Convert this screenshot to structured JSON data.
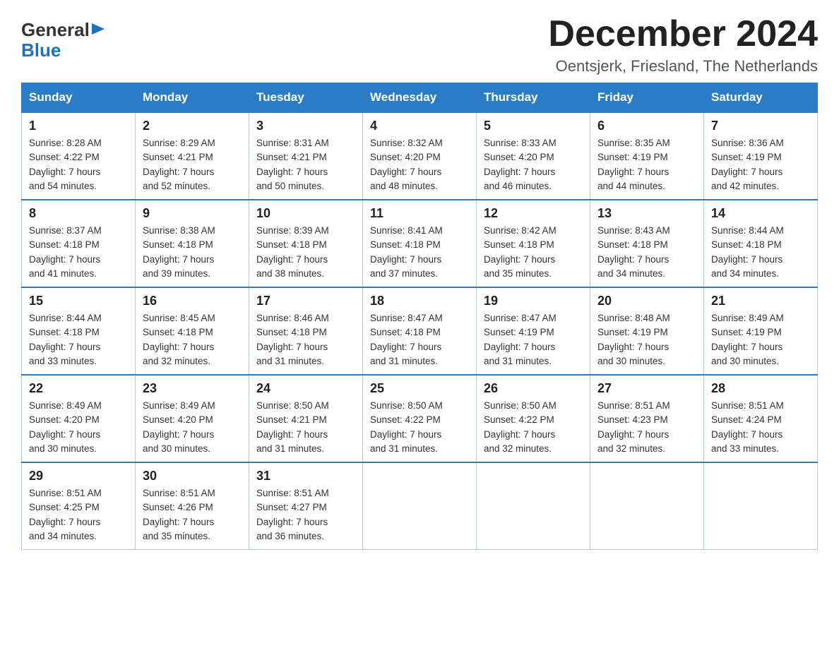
{
  "header": {
    "logo_general": "General",
    "logo_blue": "Blue",
    "month_title": "December 2024",
    "location": "Oentsjerk, Friesland, The Netherlands"
  },
  "days_of_week": [
    "Sunday",
    "Monday",
    "Tuesday",
    "Wednesday",
    "Thursday",
    "Friday",
    "Saturday"
  ],
  "weeks": [
    [
      {
        "day": "1",
        "sunrise": "8:28 AM",
        "sunset": "4:22 PM",
        "daylight": "7 hours and 54 minutes."
      },
      {
        "day": "2",
        "sunrise": "8:29 AM",
        "sunset": "4:21 PM",
        "daylight": "7 hours and 52 minutes."
      },
      {
        "day": "3",
        "sunrise": "8:31 AM",
        "sunset": "4:21 PM",
        "daylight": "7 hours and 50 minutes."
      },
      {
        "day": "4",
        "sunrise": "8:32 AM",
        "sunset": "4:20 PM",
        "daylight": "7 hours and 48 minutes."
      },
      {
        "day": "5",
        "sunrise": "8:33 AM",
        "sunset": "4:20 PM",
        "daylight": "7 hours and 46 minutes."
      },
      {
        "day": "6",
        "sunrise": "8:35 AM",
        "sunset": "4:19 PM",
        "daylight": "7 hours and 44 minutes."
      },
      {
        "day": "7",
        "sunrise": "8:36 AM",
        "sunset": "4:19 PM",
        "daylight": "7 hours and 42 minutes."
      }
    ],
    [
      {
        "day": "8",
        "sunrise": "8:37 AM",
        "sunset": "4:18 PM",
        "daylight": "7 hours and 41 minutes."
      },
      {
        "day": "9",
        "sunrise": "8:38 AM",
        "sunset": "4:18 PM",
        "daylight": "7 hours and 39 minutes."
      },
      {
        "day": "10",
        "sunrise": "8:39 AM",
        "sunset": "4:18 PM",
        "daylight": "7 hours and 38 minutes."
      },
      {
        "day": "11",
        "sunrise": "8:41 AM",
        "sunset": "4:18 PM",
        "daylight": "7 hours and 37 minutes."
      },
      {
        "day": "12",
        "sunrise": "8:42 AM",
        "sunset": "4:18 PM",
        "daylight": "7 hours and 35 minutes."
      },
      {
        "day": "13",
        "sunrise": "8:43 AM",
        "sunset": "4:18 PM",
        "daylight": "7 hours and 34 minutes."
      },
      {
        "day": "14",
        "sunrise": "8:44 AM",
        "sunset": "4:18 PM",
        "daylight": "7 hours and 34 minutes."
      }
    ],
    [
      {
        "day": "15",
        "sunrise": "8:44 AM",
        "sunset": "4:18 PM",
        "daylight": "7 hours and 33 minutes."
      },
      {
        "day": "16",
        "sunrise": "8:45 AM",
        "sunset": "4:18 PM",
        "daylight": "7 hours and 32 minutes."
      },
      {
        "day": "17",
        "sunrise": "8:46 AM",
        "sunset": "4:18 PM",
        "daylight": "7 hours and 31 minutes."
      },
      {
        "day": "18",
        "sunrise": "8:47 AM",
        "sunset": "4:18 PM",
        "daylight": "7 hours and 31 minutes."
      },
      {
        "day": "19",
        "sunrise": "8:47 AM",
        "sunset": "4:19 PM",
        "daylight": "7 hours and 31 minutes."
      },
      {
        "day": "20",
        "sunrise": "8:48 AM",
        "sunset": "4:19 PM",
        "daylight": "7 hours and 30 minutes."
      },
      {
        "day": "21",
        "sunrise": "8:49 AM",
        "sunset": "4:19 PM",
        "daylight": "7 hours and 30 minutes."
      }
    ],
    [
      {
        "day": "22",
        "sunrise": "8:49 AM",
        "sunset": "4:20 PM",
        "daylight": "7 hours and 30 minutes."
      },
      {
        "day": "23",
        "sunrise": "8:49 AM",
        "sunset": "4:20 PM",
        "daylight": "7 hours and 30 minutes."
      },
      {
        "day": "24",
        "sunrise": "8:50 AM",
        "sunset": "4:21 PM",
        "daylight": "7 hours and 31 minutes."
      },
      {
        "day": "25",
        "sunrise": "8:50 AM",
        "sunset": "4:22 PM",
        "daylight": "7 hours and 31 minutes."
      },
      {
        "day": "26",
        "sunrise": "8:50 AM",
        "sunset": "4:22 PM",
        "daylight": "7 hours and 32 minutes."
      },
      {
        "day": "27",
        "sunrise": "8:51 AM",
        "sunset": "4:23 PM",
        "daylight": "7 hours and 32 minutes."
      },
      {
        "day": "28",
        "sunrise": "8:51 AM",
        "sunset": "4:24 PM",
        "daylight": "7 hours and 33 minutes."
      }
    ],
    [
      {
        "day": "29",
        "sunrise": "8:51 AM",
        "sunset": "4:25 PM",
        "daylight": "7 hours and 34 minutes."
      },
      {
        "day": "30",
        "sunrise": "8:51 AM",
        "sunset": "4:26 PM",
        "daylight": "7 hours and 35 minutes."
      },
      {
        "day": "31",
        "sunrise": "8:51 AM",
        "sunset": "4:27 PM",
        "daylight": "7 hours and 36 minutes."
      },
      null,
      null,
      null,
      null
    ]
  ],
  "labels": {
    "sunrise": "Sunrise:",
    "sunset": "Sunset:",
    "daylight": "Daylight:"
  }
}
